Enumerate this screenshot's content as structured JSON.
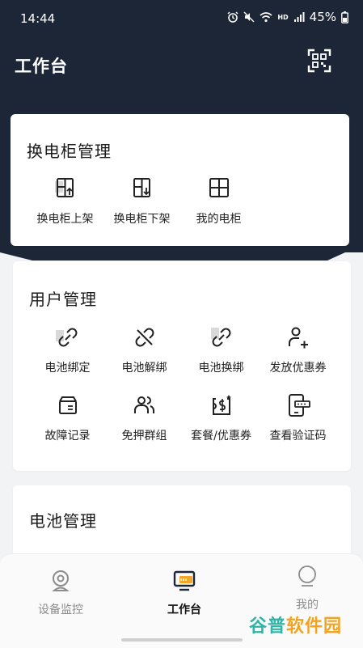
{
  "status_bar": {
    "time": "14:44",
    "hd": "HD",
    "battery": "45%"
  },
  "header": {
    "title": "工作台",
    "scan_icon": "qr-scan-icon",
    "bg_color": "#1d2636"
  },
  "cabinet_section": {
    "title": "换电柜管理",
    "items": [
      {
        "label": "换电柜上架",
        "icon": "cabinet-up-icon"
      },
      {
        "label": "换电柜下架",
        "icon": "cabinet-down-icon"
      },
      {
        "label": "我的电柜",
        "icon": "cabinet-grid-icon"
      }
    ]
  },
  "user_section": {
    "title": "用户管理",
    "items": [
      {
        "label": "电池绑定",
        "icon": "link-icon"
      },
      {
        "label": "电池解绑",
        "icon": "unlink-icon"
      },
      {
        "label": "电池换绑",
        "icon": "relink-icon"
      },
      {
        "label": "发放优惠券",
        "icon": "add-user-icon"
      },
      {
        "label": "故障记录",
        "icon": "fault-box-icon"
      },
      {
        "label": "免押群组",
        "icon": "group-icon"
      },
      {
        "label": "套餐/优惠券",
        "icon": "coupon-icon"
      },
      {
        "label": "查看验证码",
        "icon": "phone-code-icon"
      }
    ]
  },
  "battery_section": {
    "title": "电池管理"
  },
  "tabbar": {
    "tabs": [
      {
        "label": "设备监控",
        "icon": "camera-icon",
        "active": false
      },
      {
        "label": "工作台",
        "icon": "workbench-icon",
        "active": true
      },
      {
        "label": "我的",
        "icon": "profile-icon",
        "active": false
      }
    ]
  },
  "watermark": {
    "part1": "谷普",
    "part2": "软件园"
  }
}
